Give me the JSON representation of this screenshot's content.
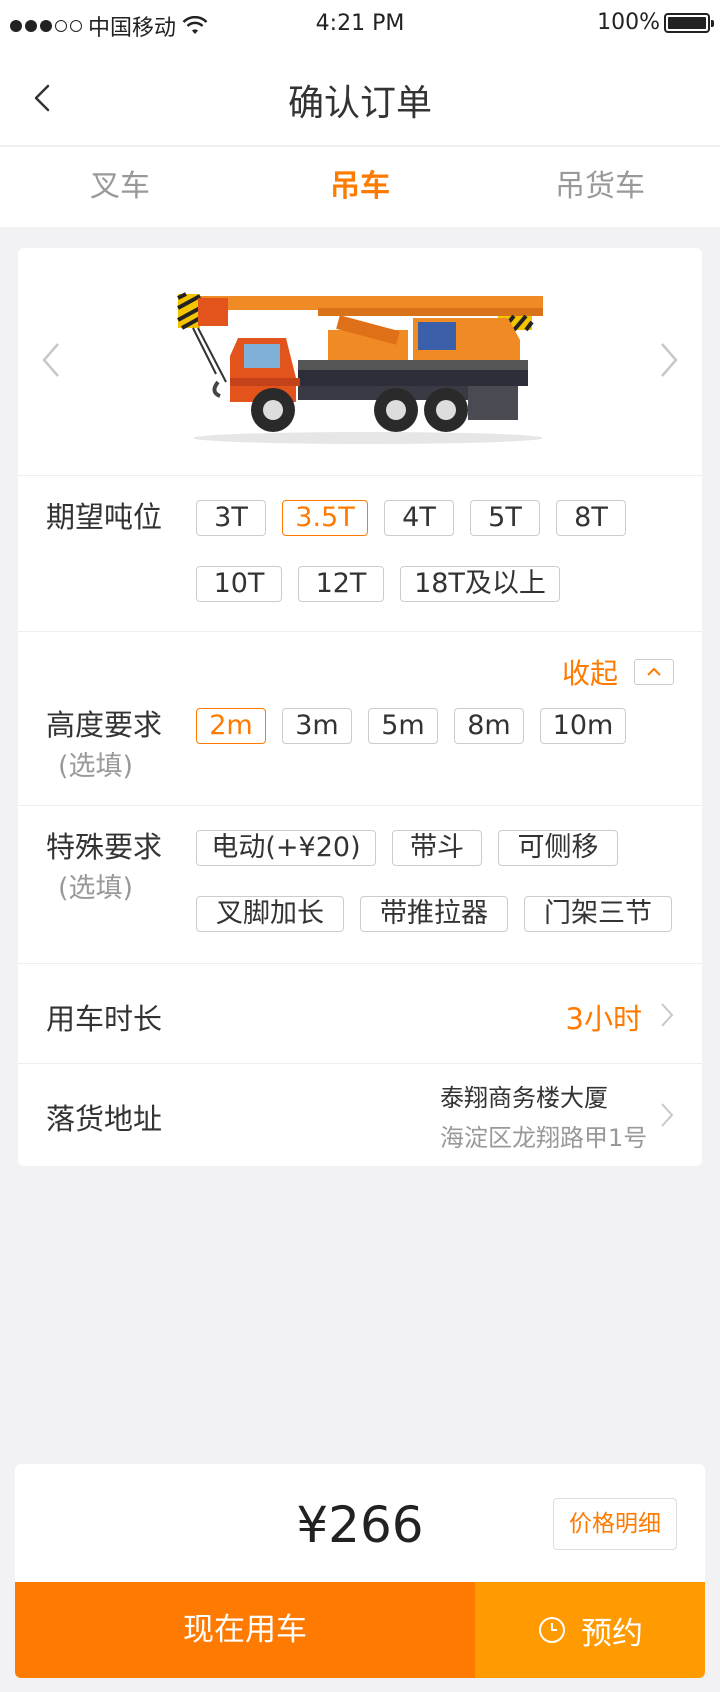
{
  "status_bar": {
    "carrier": "中国移动",
    "time": "4:21 PM",
    "battery": "100%"
  },
  "nav": {
    "title": "确认订单",
    "back_icon": "chevron-left-icon"
  },
  "tabs": [
    {
      "label": "叉车",
      "active": false
    },
    {
      "label": "吊车",
      "active": true
    },
    {
      "label": "吊货车",
      "active": false
    }
  ],
  "tonnage": {
    "label": "期望吨位",
    "options": [
      "3T",
      "3.5T",
      "4T",
      "5T",
      "8T",
      "10T",
      "12T",
      "18T及以上"
    ],
    "selected": "3.5T"
  },
  "height": {
    "collapse_label": "收起",
    "label": "高度要求",
    "sublabel": "(选填)",
    "options": [
      "2m",
      "3m",
      "5m",
      "8m",
      "10m"
    ],
    "selected": "2m"
  },
  "special": {
    "label": "特殊要求",
    "sublabel": "(选填)",
    "options": [
      "电动(+¥20)",
      "带斗",
      "可侧移",
      "叉脚加长",
      "带推拉器",
      "门架三节"
    ]
  },
  "duration": {
    "label": "用车时长",
    "value": "3小时"
  },
  "address": {
    "label": "落货地址",
    "line1": "泰翔商务楼大厦",
    "line2": "海淀区龙翔路甲1号"
  },
  "footer": {
    "price": "¥266",
    "detail_label": "价格明细",
    "now_label": "现在用车",
    "book_label": "预约"
  },
  "colors": {
    "accent": "#ff7a00",
    "accent_light": "#ff9a00"
  }
}
